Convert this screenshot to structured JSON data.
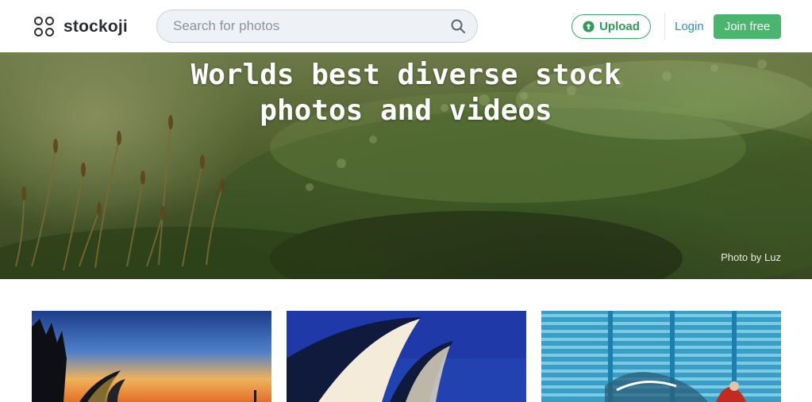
{
  "brand": {
    "name": "stockoji"
  },
  "search": {
    "placeholder": "Search for photos"
  },
  "nav": {
    "upload_label": "Upload",
    "login_label": "Login",
    "join_label": "Join free"
  },
  "hero": {
    "title_line1": "Worlds best diverse stock",
    "title_line2": "photos and videos",
    "credit": "Photo by Luz"
  },
  "colors": {
    "accent_green": "#4bb56d",
    "link_blue": "#2b8fd3",
    "upload_green": "#2e9a5a"
  },
  "icons": {
    "logo": "four-circles-logo-icon",
    "search": "search-icon",
    "upload": "upload-arrow-icon"
  },
  "gallery": {
    "items": [
      {
        "subject": "sunset-opera-house-silhouette"
      },
      {
        "subject": "opera-house-sails-night"
      },
      {
        "subject": "graffiti-shutter-wall"
      }
    ]
  }
}
